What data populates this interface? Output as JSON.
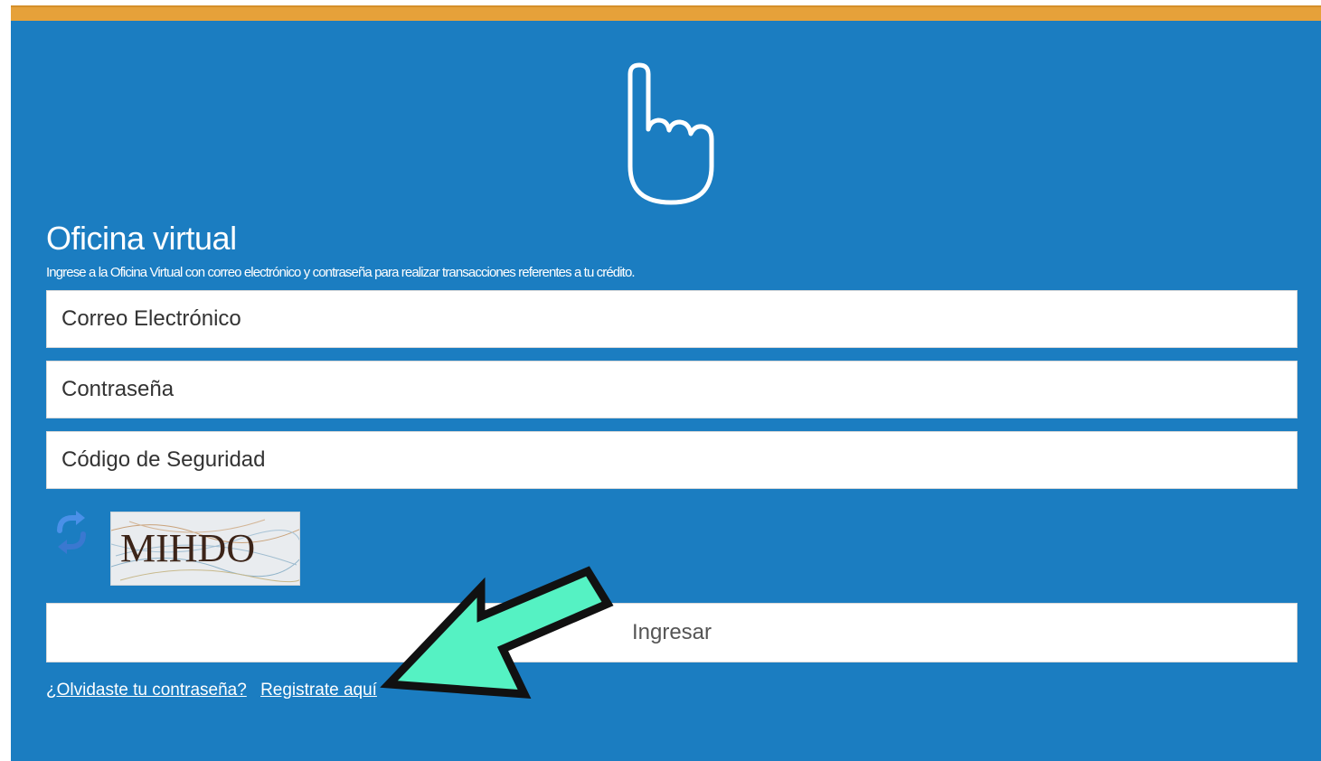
{
  "header": {
    "title": "Oficina virtual",
    "subtitle": "Ingrese a la Oficina Virtual con correo electrónico y contraseña para realizar transacciones referentes a tu crédito."
  },
  "form": {
    "email_placeholder": "Correo Electrónico",
    "password_placeholder": "Contraseña",
    "code_placeholder": "Código de Seguridad",
    "captcha_text": "MIHDO",
    "submit_label": "Ingresar"
  },
  "links": {
    "forgot_password": "¿Olvidaste tu contraseña?",
    "register": "Registrate aquí"
  },
  "icons": {
    "top": "pointing-hand-icon",
    "refresh": "refresh-icon",
    "annotation": "arrow-annotation"
  },
  "colors": {
    "panel": "#1b7dc1",
    "top_bar": "#e6a13a",
    "arrow_fill": "#55f2c3",
    "text": "#ffffff"
  }
}
